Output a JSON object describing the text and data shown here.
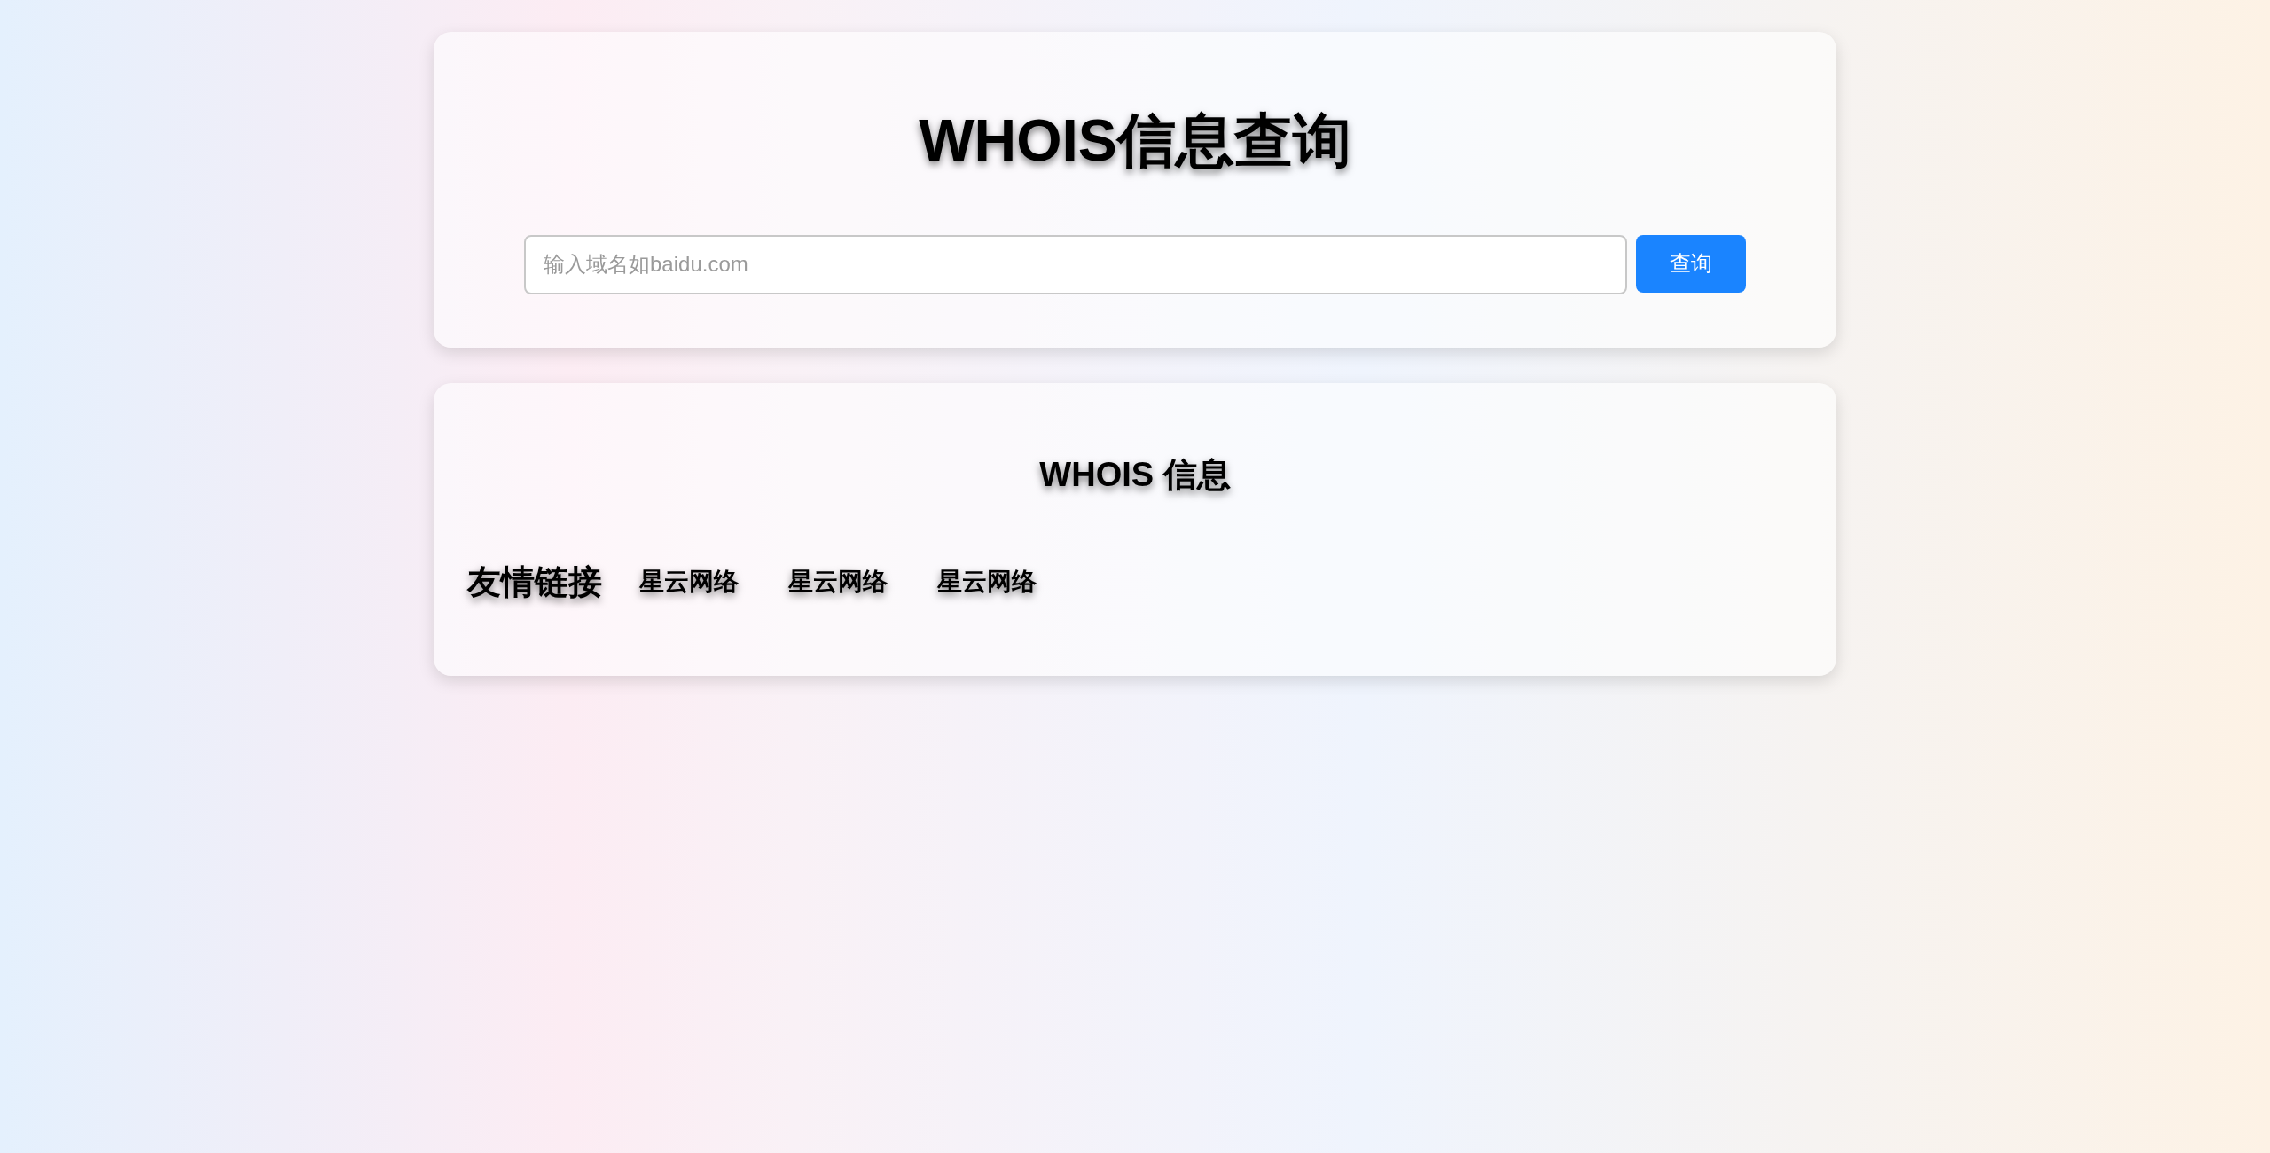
{
  "header": {
    "title": "WHOIS信息查询"
  },
  "search": {
    "placeholder": "输入域名如baidu.com",
    "button": "查询"
  },
  "result": {
    "title": "WHOIS 信息"
  },
  "friend_links": {
    "label": "友情链接",
    "links": [
      "星云网络",
      "星云网络",
      "星云网络"
    ]
  }
}
